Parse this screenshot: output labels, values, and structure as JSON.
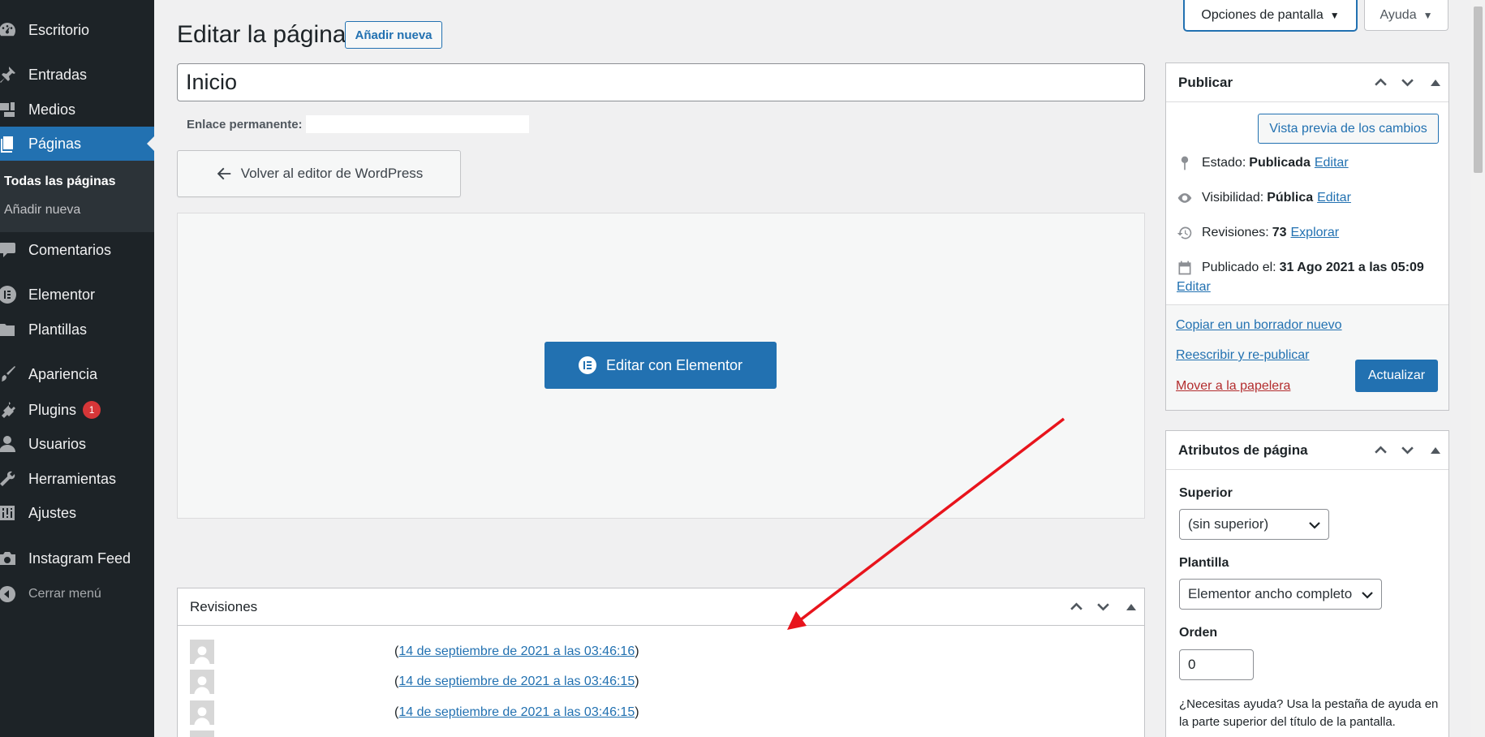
{
  "sidebar": {
    "items": [
      {
        "label": "Escritorio",
        "icon": "dashboard-icon"
      },
      {
        "label": "Entradas",
        "icon": "pin-icon"
      },
      {
        "label": "Medios",
        "icon": "media-icon"
      },
      {
        "label": "Páginas",
        "icon": "pages-icon",
        "active": true
      },
      {
        "label": "Comentarios",
        "icon": "comments-icon"
      },
      {
        "label": "Elementor",
        "icon": "elementor-icon"
      },
      {
        "label": "Plantillas",
        "icon": "folder-icon"
      },
      {
        "label": "Apariencia",
        "icon": "brush-icon"
      },
      {
        "label": "Plugins",
        "icon": "plug-icon",
        "badge": "1"
      },
      {
        "label": "Usuarios",
        "icon": "user-icon"
      },
      {
        "label": "Herramientas",
        "icon": "wrench-icon"
      },
      {
        "label": "Ajustes",
        "icon": "settings-icon"
      },
      {
        "label": "Instagram Feed",
        "icon": "camera-icon"
      },
      {
        "label": "Cerrar menú",
        "icon": "collapse-icon"
      }
    ],
    "submenu": {
      "current": "Todas las páginas",
      "add": "Añadir nueva"
    }
  },
  "header": {
    "title": "Editar la página",
    "add_new": "Añadir nueva",
    "screen_options": "Opciones de pantalla",
    "help": "Ayuda"
  },
  "editor": {
    "post_title": "Inicio",
    "permalink_label": "Enlace permanente:",
    "back_button": "Volver al editor de WordPress",
    "elementor_button": "Editar con Elementor"
  },
  "revisions": {
    "title": "Revisiones",
    "rows": [
      {
        "date": "14 de septiembre de 2021 a las 03:46:16"
      },
      {
        "date": "14 de septiembre de 2021 a las 03:46:15"
      },
      {
        "date": "14 de septiembre de 2021 a las 03:46:15"
      }
    ]
  },
  "publish": {
    "title": "Publicar",
    "preview": "Vista previa de los cambios",
    "status_label": "Estado:",
    "status_value": "Publicada",
    "status_edit": "Editar",
    "visibility_label": "Visibilidad:",
    "visibility_value": "Pública",
    "visibility_edit": "Editar",
    "revisions_label": "Revisiones:",
    "revisions_value": "73",
    "revisions_link": "Explorar",
    "published_label": "Publicado el:",
    "published_value": "31 Ago 2021 a las 05:09",
    "published_edit": "Editar",
    "copy_draft": "Copiar en un borrador nuevo",
    "rewrite": "Reescribir y re-publicar",
    "trash": "Mover a la papelera",
    "update": "Actualizar"
  },
  "attributes": {
    "title": "Atributos de página",
    "parent_label": "Superior",
    "parent_value": "(sin superior)",
    "template_label": "Plantilla",
    "template_value": "Elementor ancho completo",
    "order_label": "Orden",
    "order_value": "0",
    "help_text": "¿Necesitas ayuda? Usa la pestaña de ayuda en la parte superior del título de la pantalla."
  },
  "colors": {
    "sidebar_bg": "#1d2327",
    "accent": "#2271b1",
    "annotation_arrow": "#e8141c",
    "badge": "#d63638"
  }
}
